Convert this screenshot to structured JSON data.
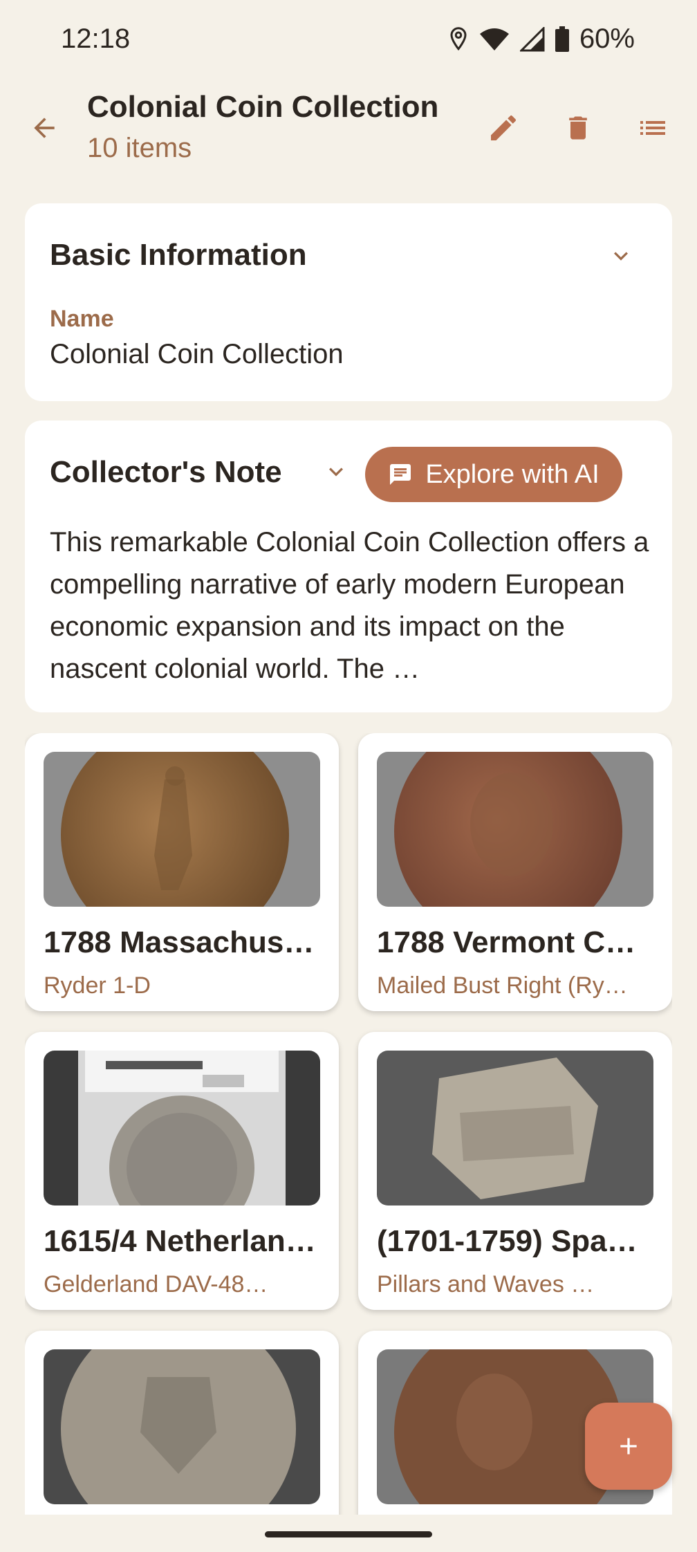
{
  "status": {
    "time": "12:18",
    "battery": "60%"
  },
  "appbar": {
    "title": "Colonial Coin Collection",
    "subtitle": "10 items",
    "icons": [
      "back-arrow-icon",
      "edit-icon",
      "delete-icon",
      "list-view-icon"
    ]
  },
  "basic": {
    "header": "Basic Information",
    "field_label": "Name",
    "field_value": "Colonial Coin Collection"
  },
  "note": {
    "header": "Collector's Note",
    "ai_label": "Explore with AI",
    "text": "This remarkable Colonial Coin Collection offers a compelling narrative of early modern European economic expansion and its impact on the nascent colonial world.  The …"
  },
  "items": [
    {
      "title": "1788 Massachus…",
      "sub": "Ryder 1-D"
    },
    {
      "title": "1788 Vermont Co…",
      "sub": "Mailed Bust Right (Ry…"
    },
    {
      "title": "1615/4 Netherlan…",
      "sub": "Gelderland DAV-48…"
    },
    {
      "title": "(1701-1759) Spa…",
      "sub": "Pillars and Waves …"
    },
    {
      "title": "",
      "sub": ""
    },
    {
      "title": "",
      "sub": ""
    }
  ],
  "colors": {
    "accent": "#b9704f",
    "fab": "#d5795a",
    "background": "#f5f1e8",
    "secondary_text": "#9c6b4a"
  }
}
